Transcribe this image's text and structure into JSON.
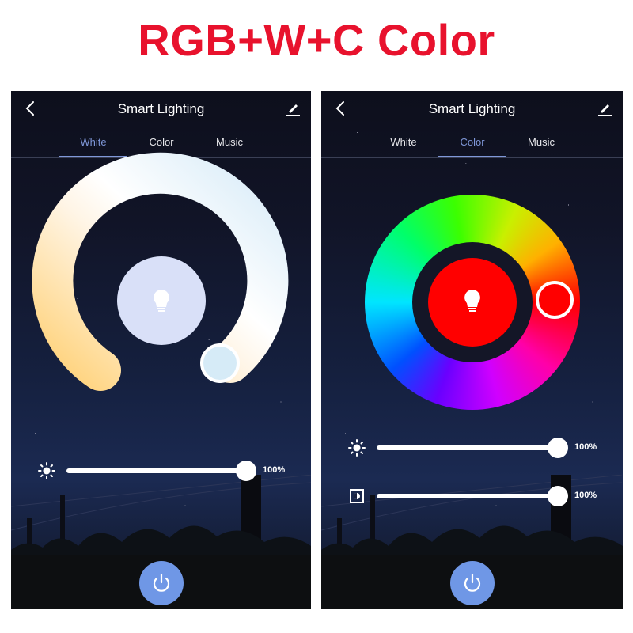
{
  "headline": "RGB+W+C Color",
  "colors": {
    "headline": "#e8122d",
    "tab_active": "#7f97d8",
    "power_button": "#6f97e6",
    "selected_color": "#ff0000",
    "white_center": "#d9e0f8"
  },
  "screens": [
    {
      "header": {
        "title": "Smart Lighting",
        "back_icon": "chevron-left-icon",
        "edit_icon": "pencil-icon"
      },
      "tabs": [
        {
          "label": "White",
          "active": true
        },
        {
          "label": "Color",
          "active": false
        },
        {
          "label": "Music",
          "active": false
        }
      ],
      "wheel": {
        "type": "color-temperature",
        "center_icon": "lightbulb-icon",
        "selected_position": "cool-white"
      },
      "sliders": [
        {
          "name": "brightness",
          "icon": "sun-icon",
          "value_label": "100%",
          "value": 1.0
        }
      ],
      "power_icon": "power-icon"
    },
    {
      "header": {
        "title": "Smart Lighting",
        "back_icon": "chevron-left-icon",
        "edit_icon": "pencil-icon"
      },
      "tabs": [
        {
          "label": "White",
          "active": false
        },
        {
          "label": "Color",
          "active": true
        },
        {
          "label": "Music",
          "active": false
        }
      ],
      "wheel": {
        "type": "hue",
        "center_icon": "lightbulb-icon",
        "selected_color": "red"
      },
      "sliders": [
        {
          "name": "brightness",
          "icon": "sun-icon",
          "value_label": "100%",
          "value": 1.0
        },
        {
          "name": "saturation",
          "icon": "contrast-icon",
          "value_label": "100%",
          "value": 1.0
        }
      ],
      "power_icon": "power-icon"
    }
  ]
}
